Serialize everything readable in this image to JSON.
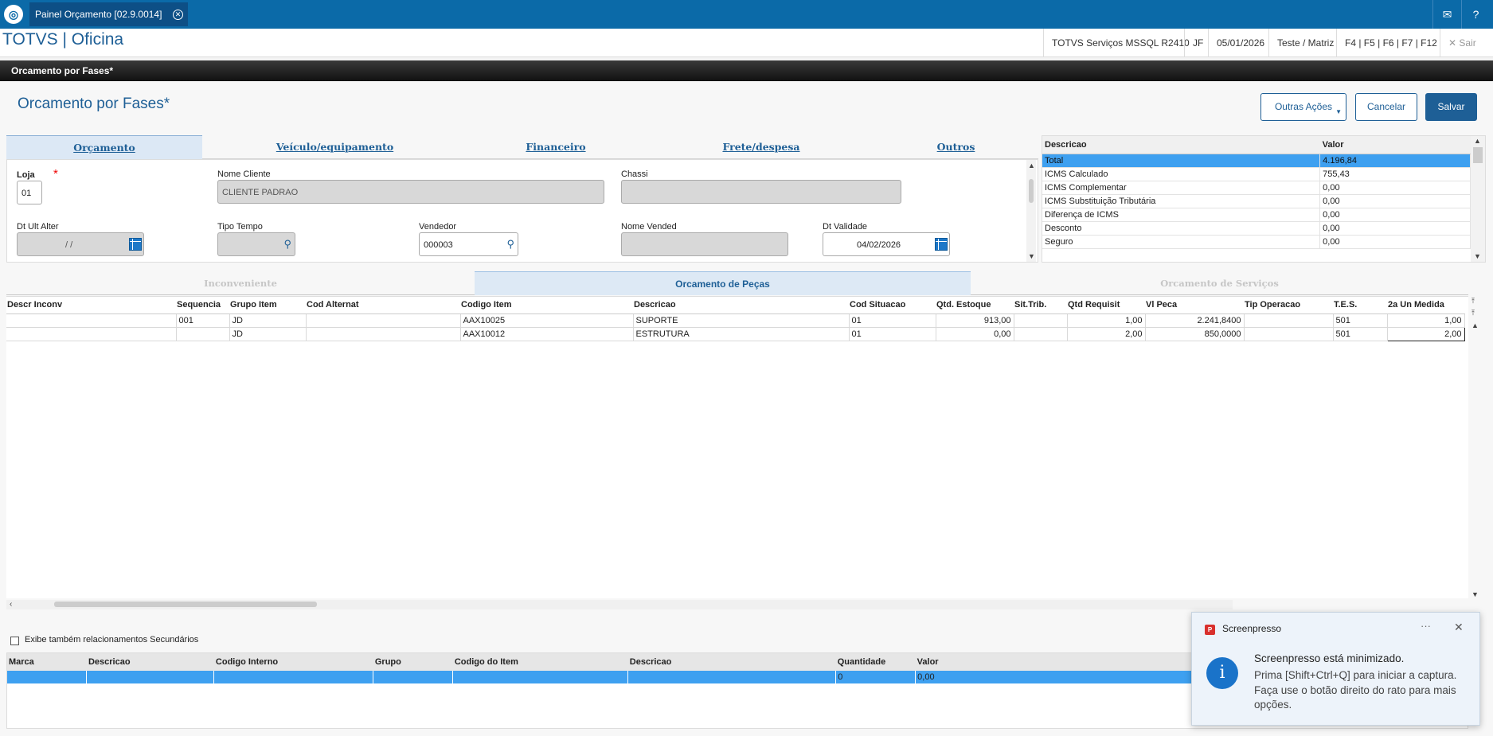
{
  "topbar": {
    "tab_title": "Painel Orçamento [02.9.0014]"
  },
  "header": {
    "app_title": "TOTVS | Oficina",
    "server": "TOTVS Serviços MSSQL R2410",
    "user": "JF",
    "date": "05/01/2026",
    "branch": "Teste / Matriz",
    "shortcuts": "F4 | F5 | F6 | F7 | F12",
    "exit": "Sair"
  },
  "window_title": "Orcamento por Fases*",
  "form": {
    "title": "Orcamento por Fases*",
    "buttons": {
      "more": "Outras Ações",
      "cancel": "Cancelar",
      "save": "Salvar"
    },
    "tabs": [
      "Orçamento",
      "Veículo/equipamento",
      "Financeiro",
      "Frete/despesa",
      "Outros"
    ],
    "fields": {
      "loja_label": "Loja",
      "loja_value": "01",
      "required_mark": "*",
      "nome_cliente_label": "Nome Cliente",
      "nome_cliente_value": "CLIENTE PADRAO",
      "chassi_label": "Chassi",
      "chassi_value": "",
      "dt_ult_alter_label": "Dt Ult Alter",
      "dt_ult_alter_value": "/ /",
      "tipo_tempo_label": "Tipo Tempo",
      "tipo_tempo_value": "",
      "vendedor_label": "Vendedor",
      "vendedor_value": "000003",
      "nome_vended_label": "Nome Vended",
      "nome_vended_value": "",
      "dt_validade_label": "Dt Validade",
      "dt_validade_value": "04/02/2026"
    }
  },
  "totals": {
    "headers": [
      "Descricao",
      "Valor"
    ],
    "rows": [
      {
        "desc": "Total",
        "value": "4.196,84"
      },
      {
        "desc": "ICMS Calculado",
        "value": "755,43"
      },
      {
        "desc": "ICMS Complementar",
        "value": "0,00"
      },
      {
        "desc": "ICMS Substituição Tributária",
        "value": "0,00"
      },
      {
        "desc": "Diferença de ICMS",
        "value": "0,00"
      },
      {
        "desc": "Desconto",
        "value": "0,00"
      },
      {
        "desc": "Seguro",
        "value": "0,00"
      }
    ]
  },
  "subtabs": [
    "Inconveniente",
    "Orcamento de Peças",
    "Orcamento de Serviços"
  ],
  "parts_grid": {
    "headers": [
      "Descr Inconv",
      "Sequencia",
      "Grupo Item",
      "Cod Alternat",
      "Codigo Item",
      "Descricao",
      "Cod Situacao",
      "Qtd. Estoque",
      "Sit.Trib.",
      "Qtd Requisit",
      "Vl Peca",
      "Tip Operacao",
      "T.E.S.",
      "2a Un Medida"
    ],
    "rows": [
      [
        "",
        "001",
        "JD",
        "",
        "AAX10025",
        "SUPORTE",
        "01",
        "913,00",
        "",
        "1,00",
        "2.241,8400",
        "",
        "501",
        "1,00"
      ],
      [
        "",
        "",
        "JD",
        "",
        "AAX10012",
        "ESTRUTURA",
        "01",
        "0,00",
        "",
        "2,00",
        "850,0000",
        "",
        "501",
        "2,00"
      ]
    ]
  },
  "secondary_checkbox_label": "Exibe também relacionamentos Secundários",
  "related_grid": {
    "headers": [
      "Marca",
      "Descricao",
      "Codigo Interno",
      "Grupo",
      "Codigo do Item",
      "Descricao",
      "Quantidade",
      "Valor"
    ],
    "rows": [
      [
        "",
        "",
        "",
        "",
        "",
        "",
        "0",
        "0,00"
      ]
    ]
  },
  "toast": {
    "app": "Screenpresso",
    "title": "Screenpresso está minimizado.",
    "body": "Prima [Shift+Ctrl+Q] para iniciar a captura. Faça use o botão direito do rato para mais opções."
  }
}
